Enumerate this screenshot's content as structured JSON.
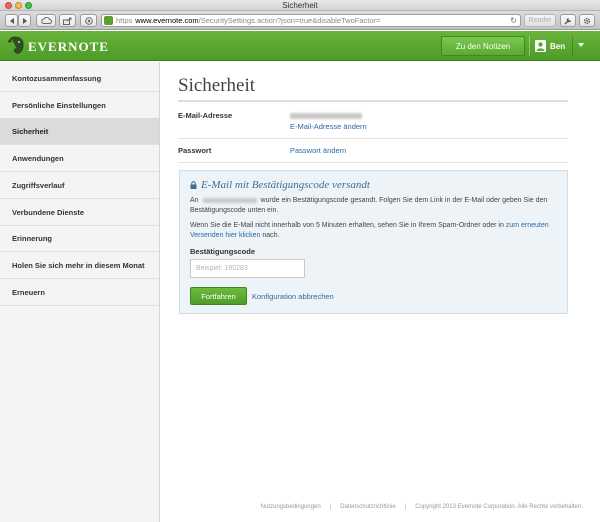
{
  "window": {
    "title": "Sicherheit"
  },
  "browser": {
    "url_scheme": "https",
    "url_host": "www.evernote.com",
    "url_path": "/SecuritySettings.action?json=true&disableTwoFactor=",
    "reader_label": "Reader"
  },
  "header": {
    "logo_text": "EVERNOTE",
    "notes_button": "Zu den Notizen",
    "user_name": "Ben",
    "brand_color": "#5aa830"
  },
  "sidebar": {
    "items": [
      {
        "label": "Kontozusammenfassung",
        "active": false
      },
      {
        "label": "Persönliche Einstellungen",
        "active": false
      },
      {
        "label": "Sicherheit",
        "active": true
      },
      {
        "label": "Anwendungen",
        "active": false
      },
      {
        "label": "Zugriffsverlauf",
        "active": false
      },
      {
        "label": "Verbundene Dienste",
        "active": false
      },
      {
        "label": "Erinnerung",
        "active": false
      },
      {
        "label": "Holen Sie sich mehr in diesem Monat",
        "active": false
      },
      {
        "label": "Erneuern",
        "active": false
      }
    ]
  },
  "main": {
    "title": "Sicherheit",
    "email": {
      "label": "E-Mail-Adresse",
      "change_link": "E-Mail-Adresse ändern"
    },
    "password": {
      "label": "Passwort",
      "change_link": "Passwort ändern"
    },
    "verify": {
      "title": "E-Mail mit Bestätigungscode versandt",
      "text_1_prefix": "An",
      "text_1_suffix": "wurde ein Bestätigungscode gesandt. Folgen Sie dem Link in der E-Mail oder geben Sie den Bestätigungscode unten ein.",
      "text_2": "Wenn Sie die E-Mail nicht innerhalb von 5 Minuten erhalten, sehen Sie in Ihrem Spam-Ordner oder in",
      "text_2_link": "zum erneuten Versenden hier klicken",
      "text_2_end": "nach.",
      "code_label": "Bestätigungscode",
      "code_placeholder": "Beispiel: 190283",
      "submit_button": "Fortfahren",
      "cancel_link": "Konfiguration abbrechen"
    }
  },
  "footer": {
    "terms": "Nutzungsbedingungen",
    "privacy": "Datenschutzrichtlinie",
    "copyright": "Copyright 2013 Evernote Corporation. Alle Rechte vorbehalten.",
    "separator": "|"
  }
}
